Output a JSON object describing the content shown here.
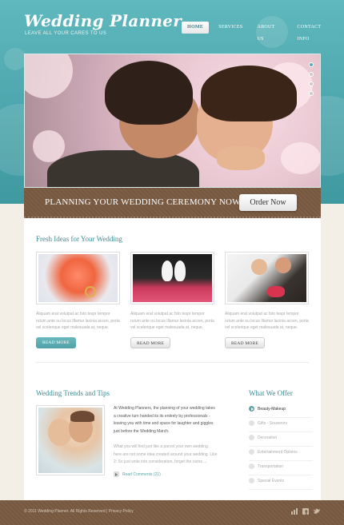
{
  "header": {
    "logo": "Wedding Planner",
    "tagline": "LEAVE ALL YOUR CARES TO US",
    "nav": [
      "HOME",
      "SERVICES",
      "ABOUT US",
      "CONTACT INFO"
    ],
    "active_nav": 0
  },
  "hero": {
    "slide_count": 4,
    "active_slide": 0
  },
  "banner": {
    "text": "PLANNING YOUR WEDDING CEREMONY NOW!",
    "button": "Order Now"
  },
  "fresh_ideas": {
    "title": "Fresh Ideas for Your Wedding",
    "cards": [
      {
        "text": "Aliquam erat volutpat ac fsto tespr tempor rutum ante ou locus Illamur lacinia accen, porta vel scelerique eget malesuada at, neque.",
        "button": "READ MORE"
      },
      {
        "text": "Aliquam erat volutpat ac fsto tespr tempor rutum ante ou locus Illamur lacinia accen, porta vel scelerique eget malesuada at, neque.",
        "button": "READ MORE"
      },
      {
        "text": "Aliquam erat volutpat ac fsto tespr tempor rutum ante ou locus Illamur lacinia accen, porta vel scelerique eget malesuada at, neque.",
        "button": "READ MORE"
      }
    ]
  },
  "trends": {
    "title": "Wedding Trends and Tips",
    "para1": "At Wedding Planners, the planning of your wedding takes a creative turn handed its its entirely by professionals - leaving you with time and space for laughter and giggles just before the Wedding March.",
    "para2": "What you will find just like a parcel your own wedding, here are not some idea created around your wedding. Like 2: So just write into consideration, forget the cares ...",
    "link": "Read Comments (21)"
  },
  "offer": {
    "title": "What We Offer",
    "items": [
      "Beauty-Makeup",
      "Gifts - Souvenirs",
      "Decoration",
      "Entertainment Options",
      "Transportation",
      "Special Events"
    ],
    "active_index": 0
  },
  "footer": {
    "text": "© 2011 Wedding Planner. All Rights Reserved  |  Privacy Policy"
  },
  "colors": {
    "teal": "#4fa5ab",
    "brown": "#7a5c44",
    "accent_text": "#3a8c92"
  }
}
